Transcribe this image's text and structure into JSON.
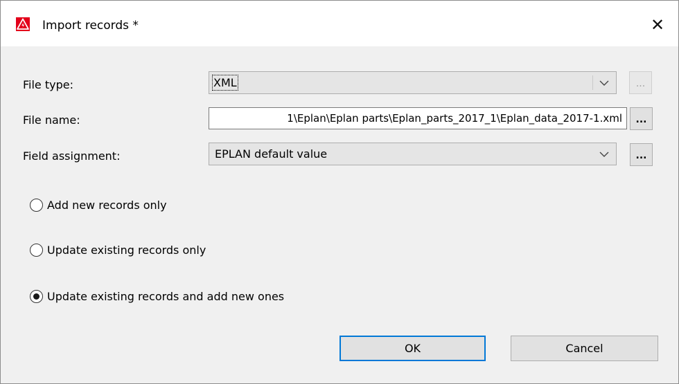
{
  "window": {
    "title": "Import records *",
    "close_glyph": "✕",
    "icon": "eplan-warning-icon"
  },
  "fields": {
    "file_type": {
      "label": "File type:",
      "value": "XML",
      "browse_label": "..."
    },
    "file_name": {
      "label": "File name:",
      "value": "1\\Eplan\\Eplan parts\\Eplan_parts_2017_1\\Eplan_data_2017-1.xml",
      "browse_label": "..."
    },
    "field_assignment": {
      "label": "Field assignment:",
      "value": "EPLAN default value",
      "browse_label": "..."
    }
  },
  "options": [
    {
      "label": "Add new records only",
      "checked": false
    },
    {
      "label": "Update existing records only",
      "checked": false
    },
    {
      "label": "Update existing records and add new ones",
      "checked": true
    }
  ],
  "buttons": {
    "ok": "OK",
    "cancel": "Cancel"
  },
  "colors": {
    "accent": "#0078d7",
    "icon_red": "#e3001b"
  }
}
